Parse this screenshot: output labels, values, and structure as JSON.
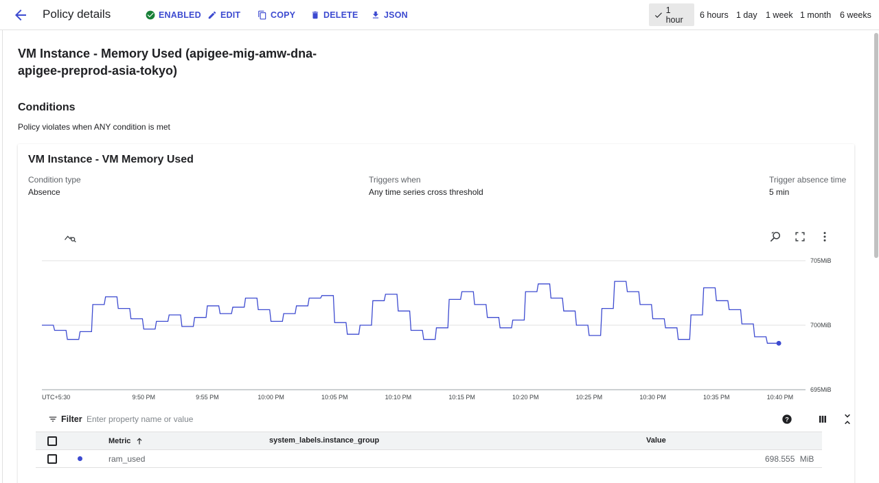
{
  "header": {
    "title": "Policy details",
    "actions": [
      "ENABLED",
      "EDIT",
      "COPY",
      "DELETE",
      "JSON"
    ],
    "time_ranges": [
      "1 hour",
      "6 hours",
      "1 day",
      "1 week",
      "1 month",
      "6 weeks"
    ],
    "selected_range": "1 hour"
  },
  "policy": {
    "title": "VM Instance - Memory Used (apigee-mig-amw-dna-apigee-preprod-asia-tokyo)"
  },
  "conditions": {
    "heading": "Conditions",
    "subtitle": "Policy violates when ANY condition is met",
    "card": {
      "title": "VM Instance - VM Memory Used",
      "condition_type_label": "Condition type",
      "condition_type_value": "Absence",
      "triggers_label": "Triggers when",
      "triggers_value": "Any time series cross threshold",
      "absence_label": "Trigger absence time",
      "absence_value": "5 min"
    }
  },
  "chart_data": {
    "type": "line",
    "x_labels": [
      "UTC+5:30",
      "9:50 PM",
      "9:55 PM",
      "10:00 PM",
      "10:05 PM",
      "10:10 PM",
      "10:15 PM",
      "10:20 PM",
      "10:25 PM",
      "10:30 PM",
      "10:35 PM",
      "10:40 PM"
    ],
    "y_labels": [
      "705MiB",
      "700MiB",
      "695MiB"
    ],
    "ylim": [
      695,
      705
    ],
    "xlim_minutes": [
      0,
      60
    ],
    "grid": true,
    "series": [
      {
        "name": "ram_used",
        "color": "#3c4ad0",
        "x_minutes": [
          0,
          0.9,
          1,
          1.9,
          2,
          2.9,
          3,
          3.9,
          4,
          4.9,
          5,
          5.9,
          6,
          6.9,
          7,
          7.9,
          8,
          8.9,
          9,
          9.9,
          10,
          10.9,
          11,
          11.9,
          12,
          12.9,
          13,
          13.9,
          14,
          14.9,
          15,
          15.9,
          16,
          16.9,
          17,
          17.9,
          18,
          18.9,
          19,
          19.9,
          20,
          20.9,
          21,
          21.9,
          22,
          22.9,
          23,
          23.9,
          24,
          24.9,
          25,
          25.9,
          26,
          26.9,
          27,
          27.9,
          28,
          28.9,
          29,
          29.9,
          30,
          30.9,
          31,
          31.9,
          32,
          32.9,
          33,
          33.9,
          34,
          34.9,
          35,
          35.9,
          36,
          36.9,
          37,
          37.9,
          38,
          38.9,
          39,
          39.9,
          40,
          40.9,
          41,
          41.9,
          42,
          42.9,
          43,
          43.9,
          44,
          44.9,
          45,
          45.9,
          46,
          46.9,
          47,
          47.9,
          48,
          48.9,
          49,
          49.9,
          50,
          50.9,
          51,
          51.9,
          52,
          52.9,
          53,
          53.9,
          54,
          54.9,
          55,
          55.9,
          56,
          56.9,
          57,
          57.9,
          58,
          58.9,
          59
        ],
        "values": [
          700,
          700,
          699.6,
          699.6,
          698.9,
          698.9,
          699.5,
          699.5,
          701.6,
          701.6,
          702.2,
          702.2,
          701.3,
          701.3,
          700.5,
          700.5,
          699.7,
          699.7,
          700.3,
          700.3,
          700.8,
          700.8,
          699.9,
          699.9,
          700.6,
          700.6,
          701.5,
          701.5,
          700.9,
          700.9,
          701.4,
          701.4,
          702.1,
          702.1,
          701.2,
          701.2,
          700.3,
          700.3,
          700.9,
          700.9,
          701.5,
          701.5,
          702.1,
          702.1,
          702.3,
          702.3,
          700.2,
          700.2,
          699.3,
          699.3,
          700.0,
          700.0,
          701.9,
          701.9,
          702.4,
          702.4,
          701.1,
          701.1,
          699.6,
          699.6,
          698.9,
          698.9,
          699.8,
          699.8,
          702.0,
          702.0,
          702.6,
          702.6,
          701.6,
          701.6,
          700.6,
          700.6,
          699.8,
          699.8,
          700.4,
          700.4,
          702.6,
          702.6,
          703.2,
          703.2,
          702.1,
          702.1,
          701.1,
          701.1,
          700.0,
          700.0,
          699.2,
          699.2,
          701.3,
          701.3,
          703.4,
          703.4,
          702.6,
          702.6,
          701.6,
          701.6,
          700.5,
          700.5,
          699.8,
          699.8,
          698.9,
          698.9,
          700.8,
          700.8,
          702.9,
          702.9,
          701.9,
          701.9,
          701.2,
          701.2,
          700.1,
          700.1,
          699.1,
          699.1,
          698.6,
          698.6
        ]
      }
    ]
  },
  "filter": {
    "label": "Filter",
    "placeholder": "Enter property name or value"
  },
  "table": {
    "columns": [
      "Metric",
      "system_labels.instance_group",
      "Value"
    ],
    "rows": [
      {
        "metric": "ram_used",
        "instance_group": "",
        "value": "698.555",
        "unit": "MiB",
        "dot_color": "#3c4ad0"
      }
    ]
  }
}
